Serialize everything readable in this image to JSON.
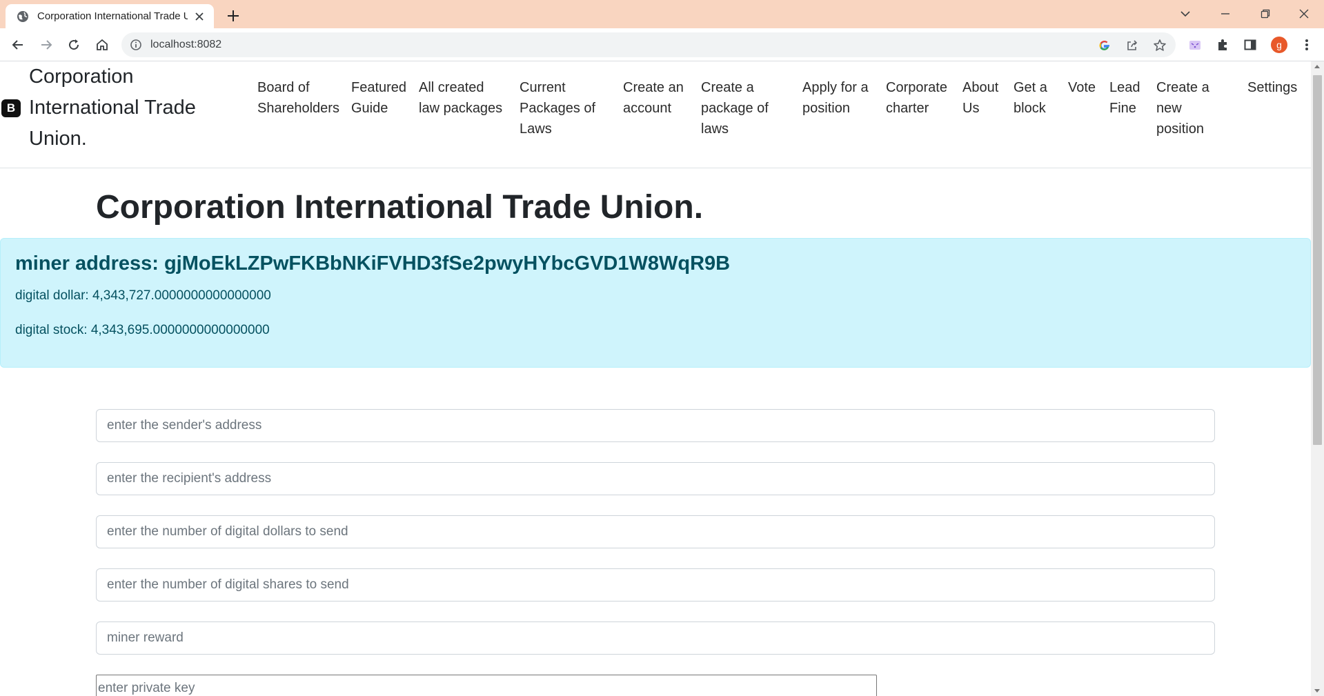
{
  "browser": {
    "tab_title": "Corporation International Trade Union.",
    "url": "localhost:8082",
    "profile_initial": "g"
  },
  "navbar": {
    "brand_logo": "B",
    "brand_lines": [
      "Corporation",
      "International Trade",
      "Union."
    ],
    "links": [
      {
        "lines": [
          "Board of",
          "Shareholders"
        ]
      },
      {
        "lines": [
          "Featured",
          "Guide"
        ]
      },
      {
        "lines": [
          "All created",
          "law packages"
        ]
      },
      {
        "lines": [
          "Current",
          "Packages of",
          "Laws"
        ]
      },
      {
        "lines": [
          "Create an",
          "account"
        ]
      },
      {
        "lines": [
          "Create a",
          "package of",
          "laws"
        ]
      },
      {
        "lines": [
          "Apply for a",
          "position"
        ]
      },
      {
        "lines": [
          "Corporate",
          "charter"
        ]
      },
      {
        "lines": [
          "About",
          "Us"
        ]
      },
      {
        "lines": [
          "Get a",
          "block"
        ]
      },
      {
        "lines": [
          "Vote"
        ]
      },
      {
        "lines": [
          "Lead",
          "Fine"
        ]
      },
      {
        "lines": [
          "Create a",
          "new",
          "position"
        ]
      },
      {
        "lines": [
          "Settings"
        ]
      }
    ]
  },
  "main": {
    "title": "Corporation International Trade Union.",
    "alert": {
      "miner_address": "miner address: gjMoEkLZPwFKBbNKiFVHD3fSe2pwyHYbcGVD1W8WqR9B",
      "digital_dollar": "digital dollar: 4,343,727.0000000000000000",
      "digital_stock": "digital stock: 4,343,695.0000000000000000"
    },
    "form": {
      "sender_placeholder": "enter the sender's address",
      "recipient_placeholder": "enter the recipient's address",
      "dollars_placeholder": "enter the number of digital dollars to send",
      "shares_placeholder": "enter the number of digital shares to send",
      "reward_placeholder": "miner reward",
      "private_key_placeholder": "enter private key"
    }
  },
  "colors": {
    "tabbar": "#f9d5c0",
    "alert_bg": "#cff4fc",
    "alert_text": "#055160",
    "avatar": "#e8592a"
  }
}
